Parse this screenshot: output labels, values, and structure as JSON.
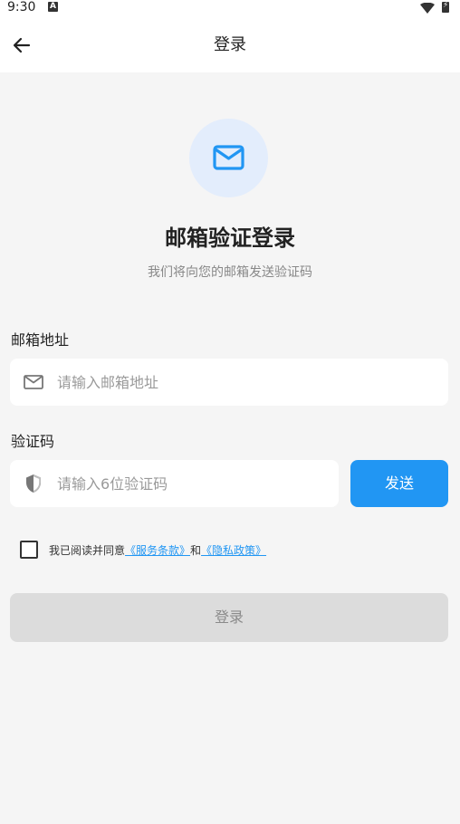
{
  "status_bar": {
    "time": "9:30",
    "notification_glyph": "A"
  },
  "app_bar": {
    "title": "登录",
    "back_icon": "arrow-left-icon"
  },
  "header": {
    "icon": "mail-icon",
    "title": "邮箱验证登录",
    "subtitle": "我们将向您的邮箱发送验证码"
  },
  "email": {
    "label": "邮箱地址",
    "placeholder": "请输入邮箱地址",
    "value": "",
    "icon": "mail-outline-icon"
  },
  "code": {
    "label": "验证码",
    "placeholder": "请输入6位验证码",
    "value": "",
    "icon": "shield-icon",
    "send_label": "发送"
  },
  "agreement": {
    "checked": false,
    "prefix": "我已阅读并同意",
    "terms": "《服务条款》",
    "conjunction": "和",
    "privacy": "《隐私政策》"
  },
  "login_button": {
    "label": "登录"
  },
  "colors": {
    "accent": "#2196f3",
    "background": "#f5f5f5",
    "disabled_button": "#dcdcdc",
    "icon_circle": "#e3edfc"
  }
}
